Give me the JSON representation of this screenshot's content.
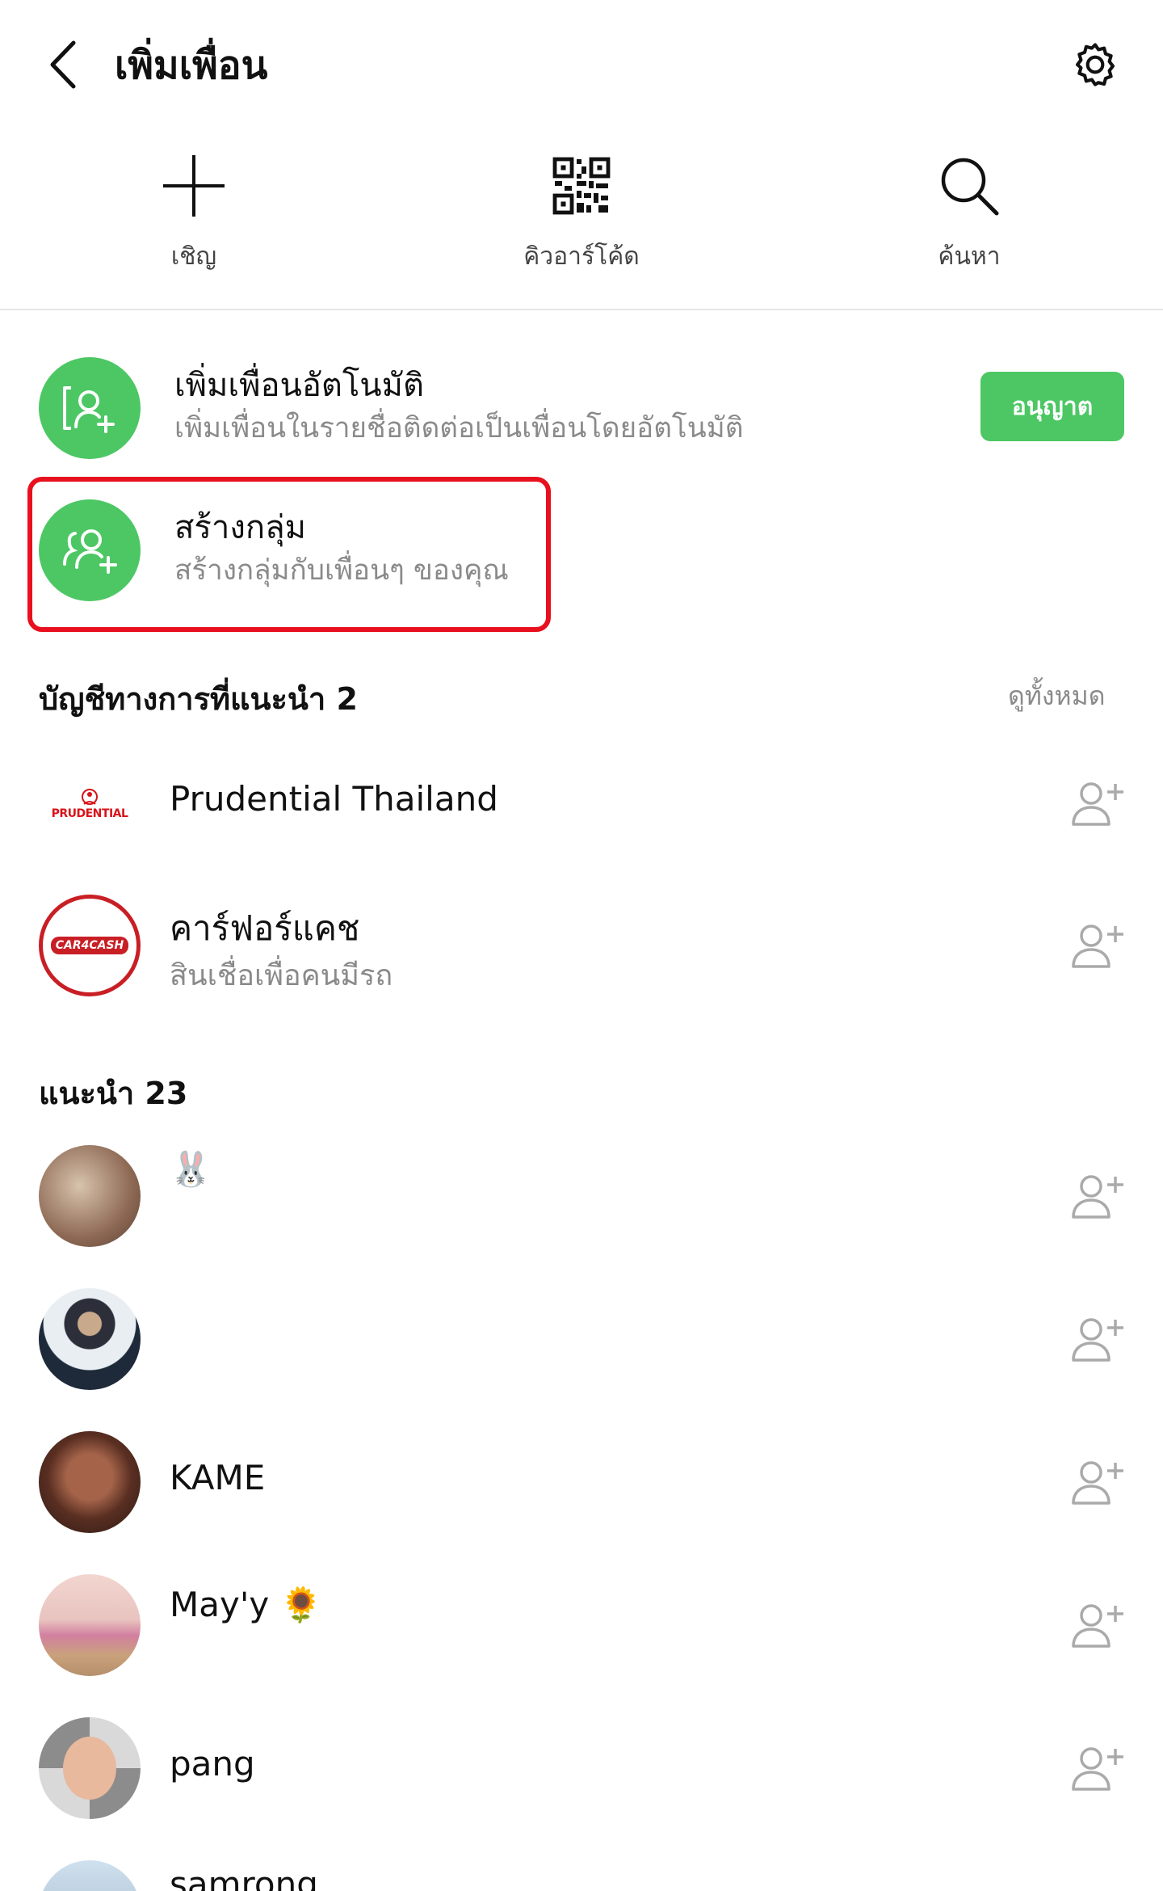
{
  "header": {
    "title": "เพิ่มเพื่อน",
    "back_icon": "chevron-left-icon",
    "settings_icon": "gear-icon"
  },
  "actions": [
    {
      "label": "เชิญ",
      "icon": "plus-icon"
    },
    {
      "label": "คิวอาร์โค้ด",
      "icon": "qr-code-icon"
    },
    {
      "label": "ค้นหา",
      "icon": "search-icon"
    }
  ],
  "auto_add": {
    "title": "เพิ่มเพื่อนอัตโนมัติ",
    "subtitle": "เพิ่มเพื่อนในรายชื่อติดต่อเป็นเพื่อนโดยอัตโนมัติ",
    "button": "อนุญาต"
  },
  "create_group": {
    "title": "สร้างกลุ่ม",
    "subtitle": "สร้างกลุ่มกับเพื่อนๆ ของคุณ"
  },
  "official": {
    "title": "บัญชีทางการที่แนะนำ 2",
    "see_all": "ดูทั้งหมด",
    "items": [
      {
        "name": "Prudential Thailand",
        "logo_text": "PRUDENTIAL"
      },
      {
        "name": "คาร์ฟอร์แคช",
        "subtitle": "สินเชื่อเพื่อคนมีรถ",
        "logo_text": "CAR4CASH"
      }
    ]
  },
  "recommended": {
    "title": "แนะนำ 23",
    "items": [
      {
        "name": "🐰"
      },
      {
        "name": ""
      },
      {
        "name": "KAME"
      },
      {
        "name": "May'y 🌻"
      },
      {
        "name": "pang"
      },
      {
        "name": "samrong"
      }
    ]
  },
  "colors": {
    "brand_green": "#4cc764",
    "highlight_red": "#e8101e",
    "muted_text": "#8a8a8a"
  }
}
